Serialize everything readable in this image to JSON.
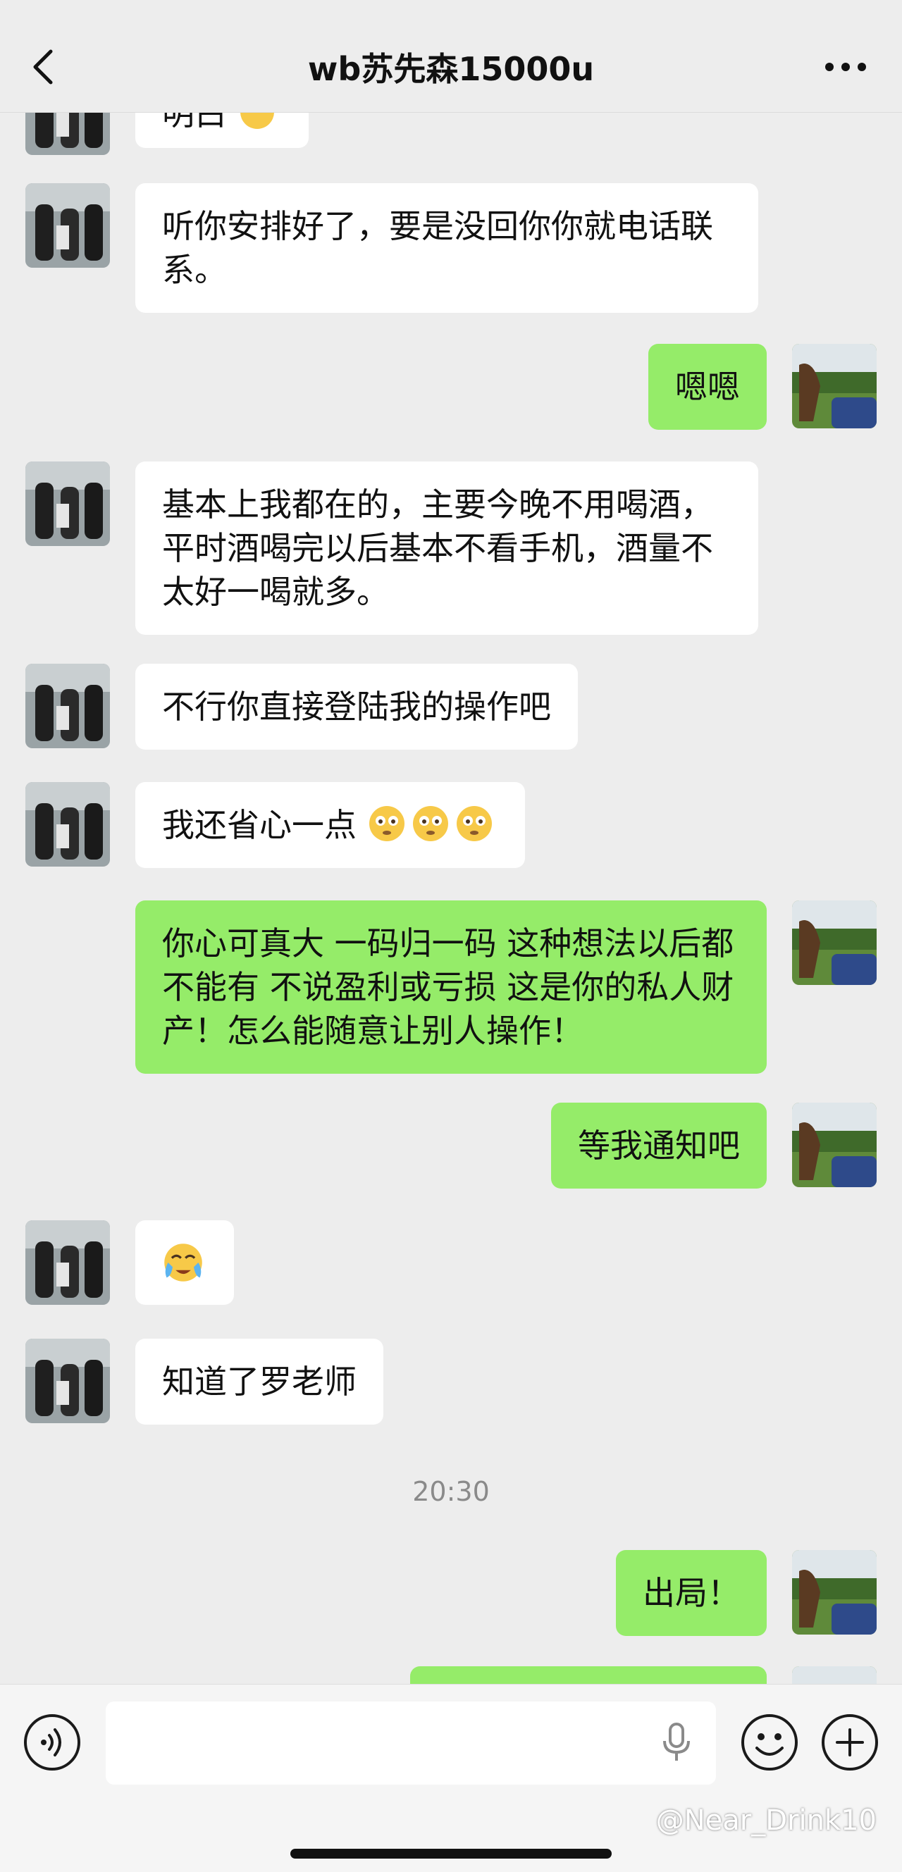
{
  "header": {
    "title": "wb苏先森15000u",
    "back_icon": "chevron-left-icon",
    "more_icon": "more-dots-icon"
  },
  "messages": [
    {
      "side": "left",
      "text": "明白",
      "emoji": "clap"
    },
    {
      "side": "left",
      "text": "听你安排好了，要是没回你你就电话联系。"
    },
    {
      "side": "right",
      "text": "嗯嗯"
    },
    {
      "side": "left",
      "text": "基本上我都在的，主要今晚不用喝酒，平时酒喝完以后基本不看手机，酒量不太好一喝就多。"
    },
    {
      "side": "left",
      "text": "不行你直接登陆我的操作吧"
    },
    {
      "side": "left",
      "text": "我还省心一点",
      "emoji": "flushed x3"
    },
    {
      "side": "right",
      "text": "你心可真大 一码归一码 这种想法以后都不能有 不说盈利或亏损 这是你的私人财产！怎么能随意让别人操作！"
    },
    {
      "side": "right",
      "text": "等我通知吧"
    },
    {
      "side": "left",
      "text": "",
      "emoji": "sob"
    },
    {
      "side": "left",
      "text": "知道了罗老师"
    },
    {
      "side": "right",
      "text": "出局！"
    }
  ],
  "timestamp": "20:30",
  "input": {
    "value": "",
    "voice_icon": "voice-icon",
    "mic_icon": "mic-icon",
    "emoji_icon": "emoji-icon",
    "plus_icon": "plus-icon"
  },
  "watermark": "@Near_Drink10",
  "colors": {
    "background": "#ededed",
    "self_bubble": "#95ec69",
    "other_bubble": "#ffffff"
  }
}
